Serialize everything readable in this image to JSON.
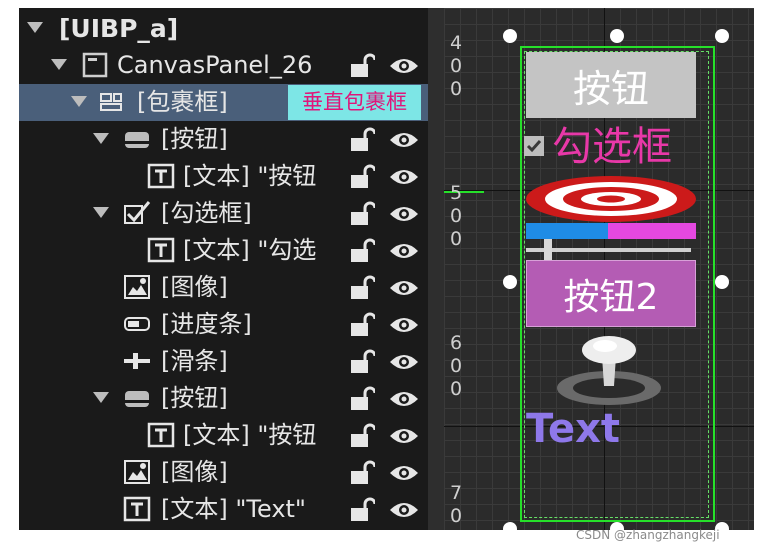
{
  "hierarchy": {
    "items": [
      {
        "label": "[UIBP_a]"
      },
      {
        "label": "CanvasPanel_26"
      },
      {
        "label": "[包裹框]",
        "tag": "垂直包裹框"
      },
      {
        "label": "[按钮]"
      },
      {
        "label": "[文本] \"按钮"
      },
      {
        "label": "[勾选框]"
      },
      {
        "label": "[文本] \"勾选"
      },
      {
        "label": "[图像]"
      },
      {
        "label": "[进度条]"
      },
      {
        "label": "[滑条]"
      },
      {
        "label": "[按钮]"
      },
      {
        "label": "[文本] \"按钮"
      },
      {
        "label": "[图像]"
      },
      {
        "label": "[文本] \"Text\""
      }
    ]
  },
  "canvas": {
    "ruler_labels": [
      {
        "digits": [
          "4",
          "0",
          "0"
        ]
      },
      {
        "digits": [
          "5",
          "0",
          "0"
        ]
      },
      {
        "digits": [
          "6",
          "0",
          "0"
        ]
      },
      {
        "digits": [
          "7",
          "0",
          "0"
        ]
      }
    ],
    "widgets": {
      "button1_label": "按钮",
      "checkbox_label": "勾选框",
      "button2_label": "按钮2",
      "text_label": "Text",
      "progress_percent": 48
    }
  },
  "colors": {
    "selection_outline": "#26e02a",
    "selected_row": "#4a5f7a",
    "tag_background": "#7de6e6",
    "tag_text": "#e0157a"
  },
  "icons": [
    "caret-down-icon",
    "widget-icon",
    "canvas-panel-icon",
    "wrap-box-icon",
    "button-icon",
    "text-icon",
    "checkbox-icon",
    "image-icon",
    "progress-bar-icon",
    "slider-icon",
    "lock-icon",
    "eye-icon"
  ],
  "watermark": "CSDN @zhangzhangkeji"
}
